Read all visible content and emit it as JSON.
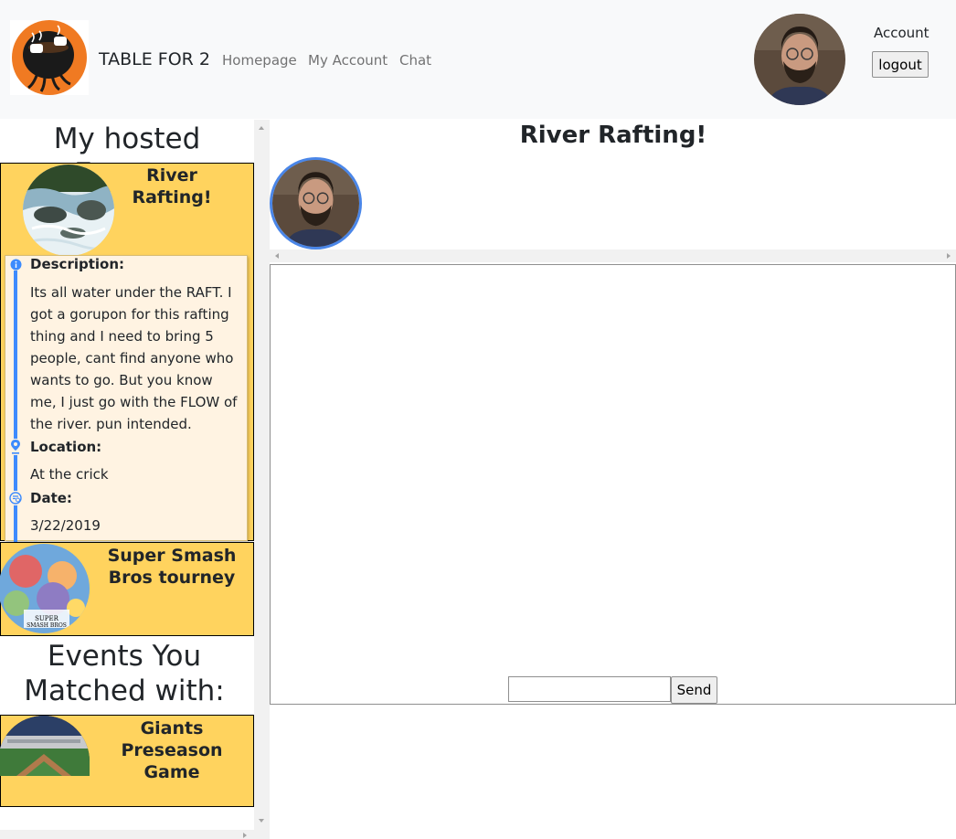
{
  "navbar": {
    "brand": "TABLE FOR 2",
    "links": [
      "Homepage",
      "My Account",
      "Chat"
    ],
    "account_label": "Account",
    "logout_label": "logout",
    "logo_icon": "coffee-table-logo",
    "avatar_icon": "user-avatar"
  },
  "sidebar": {
    "hosted_heading": "My hosted Events:",
    "hosted_events": [
      {
        "title": "River Rafting!",
        "image_icon": "river-rapids-image",
        "description_label": "Description:",
        "description": "Its all water under the RAFT. I got a gorupon for this rafting thing and I need to bring 5 people, cant find anyone who wants to go. But you know me, I just go with the FLOW of the river. pun intended.",
        "location_label": "Location:",
        "location": "At the crick",
        "date_label": "Date:",
        "date": "3/22/2019"
      },
      {
        "title": "Super Smash Bros tourney",
        "image_icon": "super-smash-bros-image"
      }
    ],
    "matched_heading": "Events You Matched with:",
    "matched_events": [
      {
        "title": "Giants Preseason Game",
        "image_icon": "baseball-stadium-image"
      }
    ]
  },
  "chat": {
    "title": "River Rafting!",
    "member_icon": "member-avatar",
    "input_value": "",
    "send_label": "Send"
  },
  "colors": {
    "navbar_bg": "#f8f9fa",
    "card_bg": "#ffd35e",
    "detail_bg": "#fff3e2",
    "timeline": "#3d8bfd",
    "avatar_ring": "#4a86e8"
  }
}
